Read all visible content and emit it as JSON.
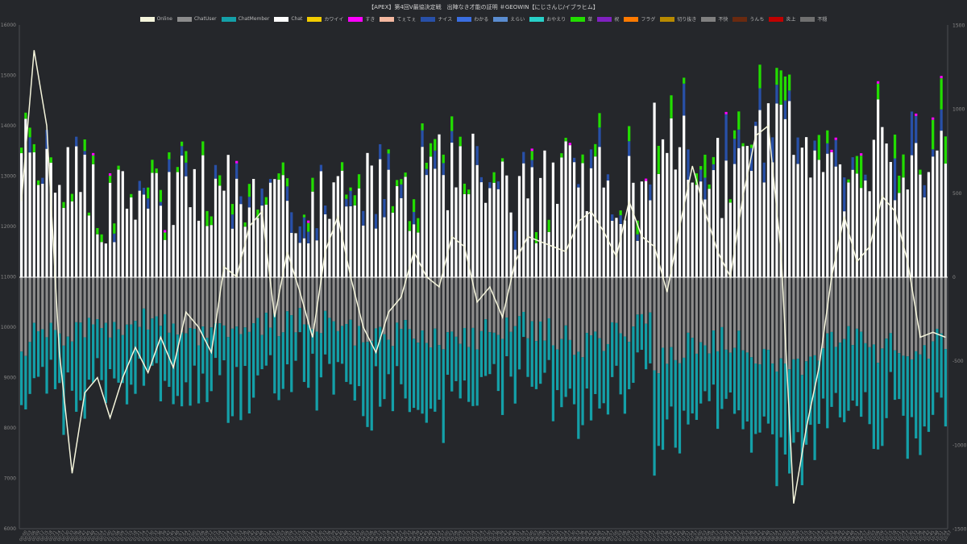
{
  "chart_data": {
    "type": "bar",
    "title": "【APEX】第4回V最協決定戦　出陣なき才能の証明 ＃GEOWIN【にじさんじ/イブラヒム】",
    "colors": {
      "Online": "#f5f5dc",
      "ChatUser": "#8c8c8c",
      "ChatMember": "#14a0a8",
      "Chat": "#ffffff",
      "カワイイ": "#f2cc00",
      "すき": "#ff00ff",
      "てぇてぇ": "#f4b8a0",
      "ナイス": "#2850a8",
      "わかる": "#3a6ee0",
      "えらい": "#5a8cd0",
      "おやえり": "#28d0c8",
      "草": "#22dd00",
      "祝": "#8020c0",
      "フラグ": "#ff7a00",
      "切り抜き": "#b88a00",
      "不快": "#808080",
      "うんち": "#6a2a10",
      "炎上": "#c00000",
      "不穏": "#707070"
    },
    "legend": [
      "Online",
      "ChatUser",
      "ChatMember",
      "Chat",
      "カワイイ",
      "すき",
      "てぇてぇ",
      "ナイス",
      "わかる",
      "えらい",
      "おやえり",
      "草",
      "祝",
      "フラグ",
      "切り抜き",
      "不快",
      "うんち",
      "炎上",
      "不穏"
    ],
    "left_axis": {
      "ticks": [
        "16000",
        "15000",
        "14000",
        "13000",
        "12000",
        "11000",
        "10000",
        "9000",
        "8000",
        "7000",
        "6000"
      ],
      "range": [
        6000,
        16000
      ]
    },
    "right_axis": {
      "ticks": [
        "1500",
        "1000",
        "500",
        "0",
        "-500",
        "-1000",
        "-1500"
      ],
      "range": [
        -1500,
        1500
      ]
    },
    "x_labels": [
      "00:00",
      "00:03",
      "00:06",
      "00:09",
      "00:12",
      "00:15",
      "00:18",
      "00:21",
      "00:24",
      "00:27",
      "00:30",
      "00:33",
      "00:36",
      "00:39",
      "00:42",
      "00:45",
      "00:48",
      "00:51",
      "00:54",
      "00:57",
      "01:00",
      "01:03",
      "01:06",
      "01:09",
      "01:12",
      "01:15",
      "01:18",
      "01:21",
      "01:24",
      "01:27",
      "01:30",
      "01:33",
      "01:36",
      "01:39",
      "01:42",
      "01:45",
      "01:48",
      "01:51",
      "01:54",
      "01:57",
      "02:00",
      "02:03",
      "02:06",
      "02:09",
      "02:12",
      "02:15",
      "02:18",
      "02:21",
      "02:24",
      "02:27",
      "02:30",
      "02:33",
      "02:36",
      "02:39",
      "02:42",
      "02:45",
      "02:48",
      "02:51",
      "02:54",
      "02:57",
      "03:00",
      "03:03",
      "03:06",
      "03:09",
      "03:12",
      "03:15",
      "03:18",
      "03:21",
      "03:24",
      "03:27",
      "03:30",
      "03:33",
      "03:36",
      "03:39",
      "03:42",
      "03:45",
      "03:48",
      "03:51",
      "03:54",
      "03:57",
      "04:00",
      "04:03",
      "04:06",
      "04:09",
      "04:12",
      "04:15",
      "04:18",
      "04:21",
      "04:24",
      "04:27",
      "04:30",
      "04:33",
      "04:36",
      "04:39",
      "04:42",
      "04:45",
      "04:48",
      "04:51",
      "04:54",
      "04:57",
      "05:00",
      "05:03",
      "05:06",
      "05:09",
      "05:12",
      "05:15",
      "05:18",
      "05:21",
      "05:24",
      "05:27",
      "05:30",
      "05:33",
      "05:36",
      "05:39",
      "05:42",
      "05:45",
      "05:48",
      "05:51",
      "05:54",
      "05:57",
      "06:00",
      "06:03",
      "06:06",
      "06:09",
      "06:12",
      "06:15",
      "06:18",
      "06:21",
      "06:24",
      "06:27",
      "06:30",
      "06:33",
      "06:36",
      "06:39",
      "06:42",
      "06:45",
      "06:48",
      "06:51",
      "06:54",
      "06:57",
      "07:00",
      "07:03",
      "07:06",
      "07:09",
      "07:12",
      "07:15",
      "07:18",
      "07:21",
      "07:24",
      "07:27",
      "07:30",
      "07:33",
      "07:36",
      "07:39",
      "07:42",
      "07:45",
      "07:48",
      "07:51",
      "07:54",
      "07:57",
      "08:00",
      "08:03",
      "08:06",
      "08:09",
      "08:12",
      "08:15",
      "08:18",
      "08:21",
      "08:24",
      "08:27",
      "08:30",
      "08:33",
      "08:36",
      "08:39",
      "08:42",
      "08:45",
      "08:48",
      "08:51",
      "08:54",
      "08:57",
      "09:00",
      "09:03",
      "09:06",
      "09:09",
      "09:12",
      "09:15",
      "09:18",
      "09:21",
      "09:24",
      "09:27",
      "09:30",
      "09:33",
      "09:36",
      "09:39",
      "09:42",
      "09:45",
      "09:48",
      "09:51",
      "09:54",
      "09:57",
      "10:00",
      "10:03",
      "10:06",
      "10:09",
      "10:12",
      "10:15",
      "10:18",
      "10:21",
      "10:24",
      "10:27",
      "10:30",
      "10:33",
      "10:36",
      "10:39",
      "10:42",
      "10:45",
      "10:48",
      "10:51",
      "10:54",
      "10:57"
    ],
    "online_keypoints": [
      [
        0,
        12500
      ],
      [
        3,
        15500
      ],
      [
        6,
        14000
      ],
      [
        9,
        9500
      ],
      [
        12,
        7100
      ],
      [
        15,
        8700
      ],
      [
        18,
        9000
      ],
      [
        21,
        8200
      ],
      [
        24,
        9000
      ],
      [
        27,
        9600
      ],
      [
        30,
        9100
      ],
      [
        33,
        9800
      ],
      [
        36,
        9200
      ],
      [
        39,
        10300
      ],
      [
        42,
        10000
      ],
      [
        45,
        9500
      ],
      [
        48,
        11200
      ],
      [
        51,
        11000
      ],
      [
        54,
        12000
      ],
      [
        57,
        12300
      ],
      [
        60,
        10200
      ],
      [
        63,
        11500
      ],
      [
        66,
        10700
      ],
      [
        69,
        9800
      ],
      [
        72,
        11500
      ],
      [
        75,
        12200
      ],
      [
        78,
        11000
      ],
      [
        81,
        10000
      ],
      [
        84,
        9500
      ],
      [
        87,
        10300
      ],
      [
        90,
        10600
      ],
      [
        93,
        11500
      ],
      [
        96,
        11000
      ],
      [
        99,
        10800
      ],
      [
        102,
        11800
      ],
      [
        105,
        11600
      ],
      [
        108,
        10500
      ],
      [
        111,
        10800
      ],
      [
        114,
        10200
      ],
      [
        117,
        11300
      ],
      [
        120,
        11800
      ],
      [
        123,
        11700
      ],
      [
        126,
        11600
      ],
      [
        129,
        11500
      ],
      [
        132,
        12100
      ],
      [
        135,
        12300
      ],
      [
        138,
        11900
      ],
      [
        141,
        11400
      ],
      [
        144,
        12500
      ],
      [
        147,
        11800
      ],
      [
        150,
        11600
      ],
      [
        153,
        10700
      ],
      [
        156,
        12000
      ],
      [
        159,
        13200
      ],
      [
        162,
        12300
      ],
      [
        165,
        11500
      ],
      [
        168,
        11000
      ],
      [
        171,
        12600
      ],
      [
        174,
        13800
      ],
      [
        177,
        14000
      ],
      [
        180,
        11500
      ],
      [
        183,
        6500
      ],
      [
        186,
        8000
      ],
      [
        189,
        9200
      ],
      [
        192,
        11000
      ],
      [
        195,
        12200
      ],
      [
        198,
        11300
      ],
      [
        201,
        11600
      ],
      [
        204,
        12600
      ],
      [
        207,
        12300
      ],
      [
        210,
        11300
      ],
      [
        213,
        9800
      ],
      [
        216,
        9900
      ],
      [
        219,
        9800
      ]
    ]
  }
}
